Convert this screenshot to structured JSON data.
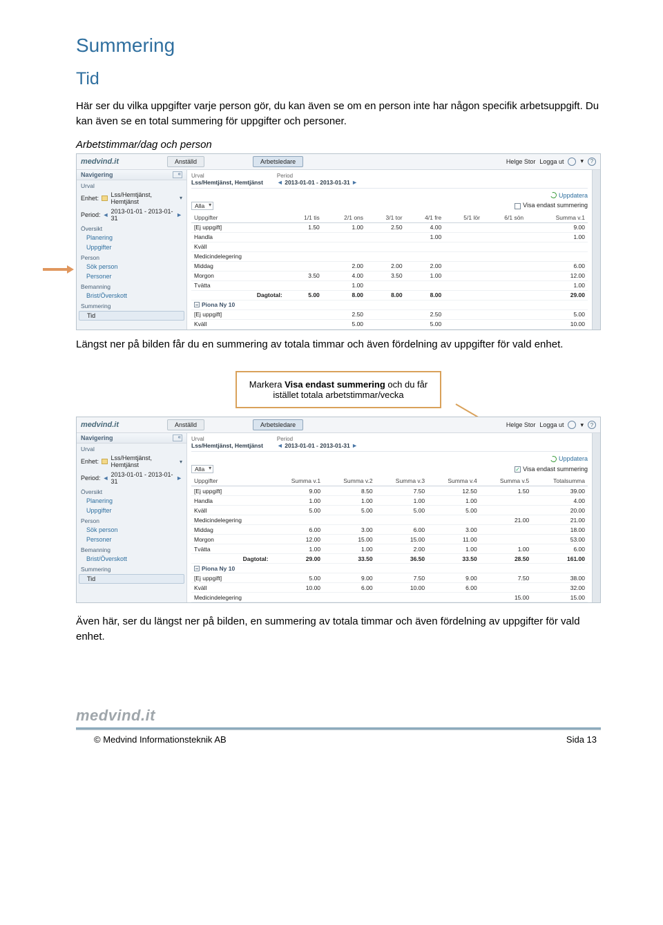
{
  "headings": {
    "main": "Summering",
    "sub": "Tid",
    "section1": "Arbetstimmar/dag och person"
  },
  "paragraphs": {
    "intro": "Här ser du vilka uppgifter varje person gör, du kan även se om en person inte har någon specifik arbetsuppgift. Du kan även se en total summering för uppgifter och personer.",
    "after_ss1": "Längst ner på bilden får du en summering av totala timmar och även fördelning av uppgifter för vald enhet.",
    "after_ss2": "Även här, ser du längst ner på bilden, en summering av totala timmar och även fördelning av uppgifter för vald enhet."
  },
  "callout": {
    "line1_a": "Markera ",
    "line1_b": "Visa endast summering",
    "line1_c": " och du får",
    "line2": "istället totala arbetstimmar/vecka"
  },
  "app": {
    "brand": "medvind.it",
    "roles": {
      "a": "Anställd",
      "b": "Arbetsledare"
    },
    "user": "Helge Stor",
    "logout": "Logga ut",
    "nav_title": "Navigering",
    "update": "Uppdatera",
    "enhet_label": "Enhet:",
    "enhet_val": "Lss/Hemtjänst, Hemtjänst",
    "period_label": "Period:",
    "period_val": "2013-01-01 - 2013-01-31",
    "groups": {
      "urval": "Urval",
      "oversikt": "Översikt",
      "person": "Person",
      "bemanning": "Bemanning",
      "summering": "Summering"
    },
    "items": {
      "planering": "Planering",
      "uppgifter": "Uppgifter",
      "sok": "Sök person",
      "personer": "Personer",
      "brist": "Brist/Överskott",
      "tid": "Tid"
    },
    "crumbs": {
      "urval_label": "Urval",
      "urval_val": "Lss/Hemtjänst, Hemtjänst",
      "period_label": "Period",
      "period_val": "2013-01-01 - 2013-01-31"
    },
    "filter_all": "Alla",
    "chk_label": "Visa endast summering"
  },
  "table1": {
    "headers": [
      "Uppgifter",
      "1/1 tis",
      "2/1 ons",
      "3/1 tor",
      "4/1 fre",
      "5/1 lör",
      "6/1 sön",
      "Summa v.1"
    ],
    "rows": [
      {
        "label": "[Ej uppgift]",
        "vals": [
          "1.50",
          "1.00",
          "2.50",
          "4.00",
          "",
          "",
          "9.00"
        ]
      },
      {
        "label": "Handla",
        "vals": [
          "",
          "",
          "",
          "1.00",
          "",
          "",
          "1.00"
        ]
      },
      {
        "label": "Kväll",
        "vals": [
          "",
          "",
          "",
          "",
          "",
          "",
          ""
        ]
      },
      {
        "label": "Medicindelegering",
        "vals": [
          "",
          "",
          "",
          "",
          "",
          "",
          ""
        ]
      },
      {
        "label": "Middag",
        "vals": [
          "",
          "2.00",
          "2.00",
          "2.00",
          "",
          "",
          "6.00"
        ]
      },
      {
        "label": "Morgon",
        "vals": [
          "3.50",
          "4.00",
          "3.50",
          "1.00",
          "",
          "",
          "12.00"
        ]
      },
      {
        "label": "Tvätta",
        "vals": [
          "",
          "1.00",
          "",
          "",
          "",
          "",
          "1.00"
        ]
      }
    ],
    "dagtotal_label": "Dagtotal:",
    "dagtotal": [
      "5.00",
      "8.00",
      "8.00",
      "8.00",
      "",
      "",
      "29.00"
    ],
    "subhead": "Piona Ny  10",
    "sub_rows": [
      {
        "label": "[Ej uppgift]",
        "vals": [
          "",
          "2.50",
          "",
          "2.50",
          "",
          "",
          "5.00"
        ]
      },
      {
        "label": "Kväll",
        "vals": [
          "",
          "5.00",
          "",
          "5.00",
          "",
          "",
          "10.00"
        ]
      }
    ]
  },
  "table2": {
    "headers": [
      "Uppgifter",
      "Summa v.1",
      "Summa v.2",
      "Summa v.3",
      "Summa v.4",
      "Summa v.5",
      "Totalsumma"
    ],
    "rows": [
      {
        "label": "[Ej uppgift]",
        "vals": [
          "9.00",
          "8.50",
          "7.50",
          "12.50",
          "1.50",
          "39.00"
        ]
      },
      {
        "label": "Handla",
        "vals": [
          "1.00",
          "1.00",
          "1.00",
          "1.00",
          "",
          "4.00"
        ]
      },
      {
        "label": "Kväll",
        "vals": [
          "5.00",
          "5.00",
          "5.00",
          "5.00",
          "",
          "20.00"
        ]
      },
      {
        "label": "Medicindelegering",
        "vals": [
          "",
          "",
          "",
          "",
          "21.00",
          "21.00"
        ]
      },
      {
        "label": "Middag",
        "vals": [
          "6.00",
          "3.00",
          "6.00",
          "3.00",
          "",
          "18.00"
        ]
      },
      {
        "label": "Morgon",
        "vals": [
          "12.00",
          "15.00",
          "15.00",
          "11.00",
          "",
          "53.00"
        ]
      },
      {
        "label": "Tvätta",
        "vals": [
          "1.00",
          "1.00",
          "2.00",
          "1.00",
          "1.00",
          "6.00"
        ]
      }
    ],
    "dagtotal_label": "Dagtotal:",
    "dagtotal": [
      "29.00",
      "33.50",
      "36.50",
      "33.50",
      "28.50",
      "161.00"
    ],
    "subhead": "Piona Ny  10",
    "sub_rows": [
      {
        "label": "[Ej uppgift]",
        "vals": [
          "5.00",
          "9.00",
          "7.50",
          "9.00",
          "7.50",
          "38.00"
        ]
      },
      {
        "label": "Kväll",
        "vals": [
          "10.00",
          "6.00",
          "10.00",
          "6.00",
          "",
          "32.00"
        ]
      },
      {
        "label": "Medicindelegering",
        "vals": [
          "",
          "",
          "",
          "",
          "15.00",
          "15.00"
        ]
      }
    ]
  },
  "footer": {
    "brand": "medvind.it",
    "copyright": "©  Medvind Informationsteknik AB",
    "page": "Sida 13"
  }
}
